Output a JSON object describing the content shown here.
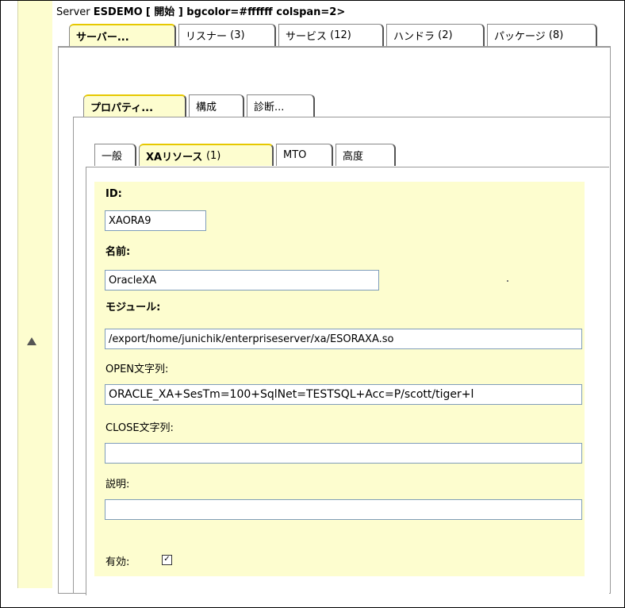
{
  "header": {
    "prefix": "Server",
    "server_name": "ESDEMO",
    "rest": "[ 開始 ] bgcolor=#ffffff colspan=2>"
  },
  "top_tabs": [
    {
      "label": "サーバー...",
      "count": "",
      "active": true
    },
    {
      "label": "リスナー",
      "count": "(3)",
      "active": false
    },
    {
      "label": "サービス",
      "count": "(12)",
      "active": false
    },
    {
      "label": "ハンドラ",
      "count": "(2)",
      "active": false
    },
    {
      "label": "パッケージ",
      "count": "(8)",
      "active": false
    }
  ],
  "second_tabs": [
    {
      "label": "プロパティ...",
      "active": true
    },
    {
      "label": "構成",
      "active": false
    },
    {
      "label": "診断...",
      "active": false
    }
  ],
  "third_tabs": [
    {
      "label": "一般",
      "count": "",
      "active": false
    },
    {
      "label": "XAリソース",
      "count": "(1)",
      "active": true
    },
    {
      "label": "MTO",
      "count": "",
      "active": false
    },
    {
      "label": "高度",
      "count": "",
      "active": false
    }
  ],
  "form": {
    "id_label": "ID:",
    "id_value": "XAORA9",
    "name_label": "名前:",
    "name_value": "OracleXA",
    "module_label": "モジュール:",
    "module_value": "/export/home/junichik/enterpriseserver/xa/ESORAXA.so",
    "open_label": "OPEN文字列:",
    "open_value": "ORACLE_XA+SesTm=100+SqlNet=TESTSQL+Acc=P/scott/tiger+l",
    "close_label": "CLOSE文字列:",
    "close_value": "",
    "desc_label": "説明:",
    "desc_value": "",
    "enabled_label": "有効:",
    "enabled_checked": true
  },
  "icons": {
    "collapse": "triangle-up-icon",
    "check": "checkmark-icon"
  },
  "colors": {
    "panel_bg": "#fdfdcf",
    "active_tab_top": "#e6c800",
    "field_border": "#7f9db9"
  }
}
